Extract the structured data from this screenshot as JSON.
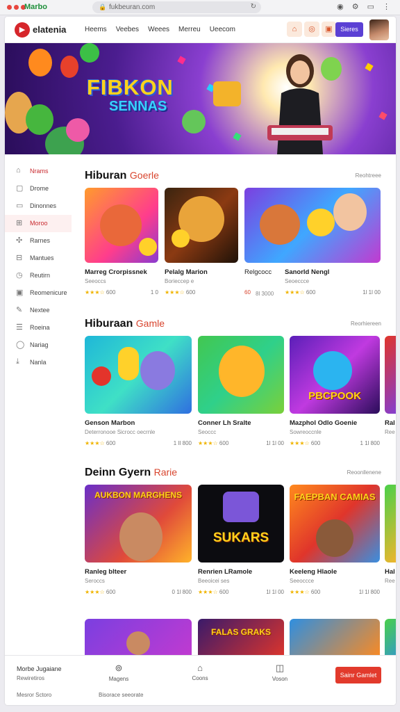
{
  "browser": {
    "title": "Marbo",
    "url": "fukbeuran.com"
  },
  "app": {
    "logo_text": "elatenia",
    "nav": [
      "Heems",
      "Veebes",
      "Weees",
      "Merreu",
      "Ueecom"
    ],
    "signin_label": "Sieres"
  },
  "hero": {
    "title": "FIBKON",
    "subtitle": "SENNAS"
  },
  "sidebar": {
    "items": [
      {
        "label": "Nrams",
        "icon": "home-icon"
      },
      {
        "label": "Drome",
        "icon": "square-icon"
      },
      {
        "label": "Dinonnes",
        "icon": "square-icon"
      },
      {
        "label": "Moroo",
        "icon": "grid-icon"
      },
      {
        "label": "Rarnes",
        "icon": "puzzle-icon"
      },
      {
        "label": "Mantues",
        "icon": "tag-icon"
      },
      {
        "label": "Reutirn",
        "icon": "clock-icon"
      },
      {
        "label": "Reomenicure",
        "icon": "monitor-icon"
      },
      {
        "label": "Nextee",
        "icon": "pencil-icon"
      },
      {
        "label": "Roeina",
        "icon": "list-icon"
      },
      {
        "label": "Nariag",
        "icon": "circle-icon"
      },
      {
        "label": "Nanla",
        "icon": "download-icon"
      }
    ]
  },
  "sections": [
    {
      "title": "Hiburan",
      "accent": "Goerle",
      "link": "Reohtreee",
      "cards": [
        {
          "title": "Marreg Crorpissnek",
          "sub": "Seeoccs",
          "rating": "600",
          "meta": "1 0"
        },
        {
          "title": "Pelalg Marion",
          "sub": "Borieccep e",
          "rating": "600",
          "meta": ""
        },
        {
          "title": "Relgcocc",
          "sub": "",
          "rating": "",
          "meta": "",
          "prefix": "60",
          "extra": "8l 3000"
        },
        {
          "title": "Sanorld Nengl",
          "sub": "Seoeccce",
          "rating": "600",
          "meta": "1l 1l 00"
        }
      ]
    },
    {
      "title": "Hiburaan",
      "accent": "Gamle",
      "link": "Reorhiereen",
      "cards": [
        {
          "title": "Genson Marbon",
          "sub": "Deterronooe Sicrocc oecrnle",
          "rating": "600",
          "meta": "1 Il 800"
        },
        {
          "title": "Conner Lh Sralte",
          "sub": "Seoccc",
          "rating": "600",
          "meta": "1l 1l 00"
        },
        {
          "title": "Mazphol Odlo Goenie",
          "sub": "Sowreoccnle",
          "rating": "600",
          "meta": "1 1l 800"
        },
        {
          "title": "Ral",
          "sub": "Ree",
          "rating": "",
          "meta": ""
        }
      ]
    },
    {
      "title": "Deinn Gyern",
      "accent": "Rarie",
      "link": "Reoonllenene",
      "cards": [
        {
          "title": "Ranleg blteer",
          "sub": "Seroccs",
          "rating": "600",
          "meta": "0 1l 800"
        },
        {
          "title": "Renrien LRamole",
          "sub": "Beeoicei ses",
          "rating": "600",
          "meta": "1l 1l 00"
        },
        {
          "title": "Keeleng Hlaole",
          "sub": "Seeoccce",
          "rating": "600",
          "meta": "1l 1l 800"
        },
        {
          "title": "Hal",
          "sub": "Ree",
          "rating": "",
          "meta": ""
        }
      ]
    }
  ],
  "thumb_words": {
    "s2c3": "PBCPOOK",
    "s3c1": "AUKBON MARGHENS",
    "s3c2": "SUKARS",
    "s3c3": "FAEPBAN CAMIAS",
    "s4c2": "FALAS GRAKS"
  },
  "bottom": {
    "line1": "Morbe Jugaiane",
    "line2": "Rewiretiros",
    "line3": "Mesror Sctoro",
    "line4": "Bisorace seeorate",
    "tabs": [
      {
        "label": "Magens",
        "icon": "gamepad-icon"
      },
      {
        "label": "Coons",
        "icon": "home-icon"
      },
      {
        "label": "Voson",
        "icon": "bell-icon"
      }
    ],
    "cta": "Sainr Gamlet"
  },
  "colors": {
    "accent": "#d8452e",
    "brand": "#5b40d4",
    "cta": "#e23a2c"
  }
}
